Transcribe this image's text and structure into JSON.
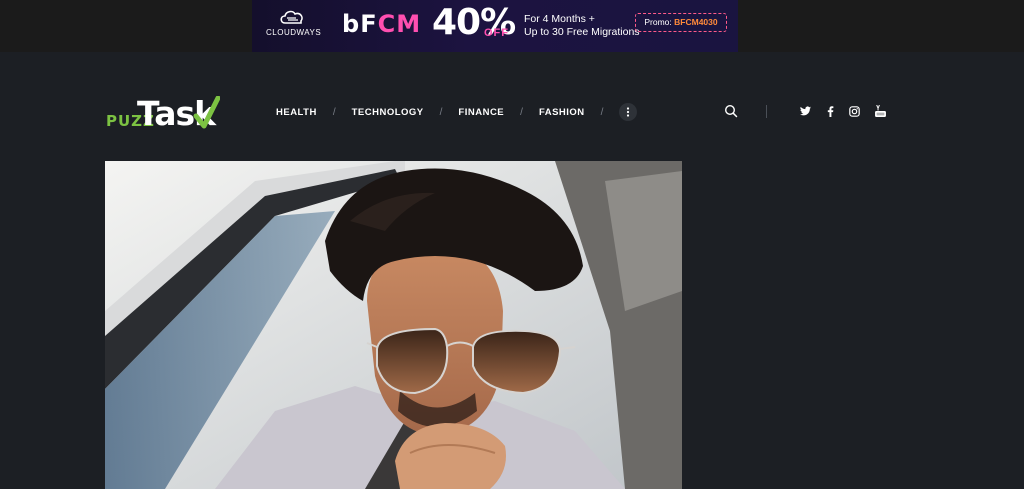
{
  "ad_banner": {
    "brand": "CLOUDWAYS",
    "bfcm_b": "b",
    "bfcm_f": "F",
    "bfcm_cm": "CM",
    "discount": "40%",
    "discount_suffix": "OFF",
    "offer_line1": "For 4 Months +",
    "offer_line2": "Up to 30 Free Migrations",
    "promo_label": "Promo:",
    "promo_code": "BFCM4030"
  },
  "site": {
    "logo_prefix": "PUZZ",
    "logo_main": "Task"
  },
  "nav": {
    "items": [
      {
        "label": "HEALTH"
      },
      {
        "label": "TECHNOLOGY"
      },
      {
        "label": "FINANCE"
      },
      {
        "label": "FASHION"
      }
    ],
    "separator": "/"
  },
  "header_icons": [
    "search-icon",
    "twitter-icon",
    "facebook-icon",
    "instagram-icon",
    "youtube-icon"
  ],
  "colors": {
    "background": "#1c1f24",
    "top_bar": "#1b1b1b",
    "logo_accent": "#7cc242",
    "promo_accent": "#ff5a8a",
    "brand_pink": "#ff4fb0"
  },
  "featured_image": {
    "description_alt": "Featured article image"
  }
}
